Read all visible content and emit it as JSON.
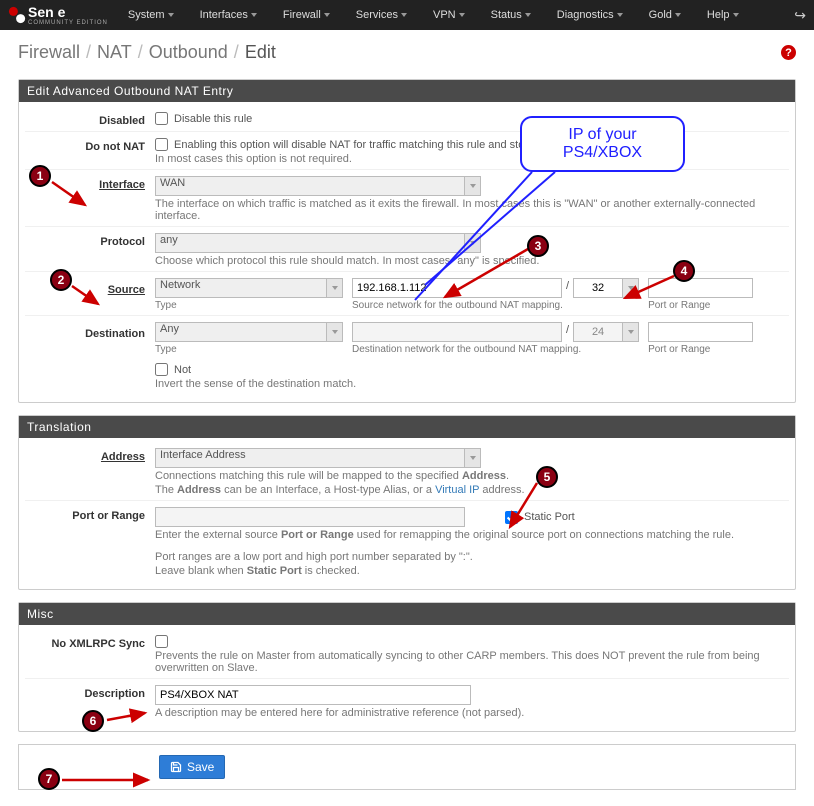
{
  "nav": {
    "logo_main": "Sen e",
    "logo_sub": "COMMUNITY EDITION",
    "items": [
      "System",
      "Interfaces",
      "Firewall",
      "Services",
      "VPN",
      "Status",
      "Diagnostics",
      "Gold",
      "Help"
    ],
    "logout_glyph": "↪"
  },
  "breadcrumb": {
    "parts": [
      "Firewall",
      "NAT",
      "Outbound",
      "Edit"
    ],
    "help_glyph": "?"
  },
  "panel1": {
    "title": "Edit Advanced Outbound NAT Entry",
    "disabled": {
      "label": "Disabled",
      "cb_label": "Disable this rule"
    },
    "donotnat": {
      "label": "Do not NAT",
      "cb_label": "Enabling this option will disable NAT for traffic matching this rule and stop proces",
      "help": "In most cases this option is not required."
    },
    "interface": {
      "label": "Interface",
      "value": "WAN",
      "help": "The interface on which traffic is matched as it exits the firewall. In most cases this is \"WAN\" or another externally-connected interface."
    },
    "protocol": {
      "label": "Protocol",
      "value": "any",
      "help": "Choose which protocol this rule should match. In most cases \"any\" is specified."
    },
    "source": {
      "label": "Source",
      "type": {
        "label": "Type",
        "value": "Network"
      },
      "addr": {
        "label": "Source network for the outbound NAT mapping.",
        "value": "192.168.1.112"
      },
      "mask": "32",
      "port": {
        "label": "Port or Range",
        "value": ""
      }
    },
    "destination": {
      "label": "Destination",
      "type": {
        "label": "Type",
        "value": "Any"
      },
      "addr": {
        "label": "Destination network for the outbound NAT mapping.",
        "value": ""
      },
      "mask": "24",
      "port": {
        "label": "Port or Range",
        "value": ""
      },
      "not_label": "Not",
      "not_help": "Invert the sense of the destination match."
    }
  },
  "panel2": {
    "title": "Translation",
    "address": {
      "label": "Address",
      "value": "Interface Address",
      "help1": "Connections matching this rule will be mapped to the specified ",
      "help1b": "Address",
      "help1c": ".",
      "help2a": "The ",
      "help2b": "Address",
      "help2c": " can be an Interface, a Host-type Alias, or a ",
      "help2link": "Virtual IP",
      "help2d": " address."
    },
    "port": {
      "label": "Port or Range",
      "static_label": "Static Port",
      "help1": "Enter the external source ",
      "help1b": "Port or Range",
      "help1c": " used for remapping the original source port on connections matching the rule.",
      "help2": "Port ranges are a low port and high port number separated by \":\".",
      "help3a": "Leave blank when ",
      "help3b": "Static Port",
      "help3c": " is checked."
    }
  },
  "panel3": {
    "title": "Misc",
    "xmlrpc": {
      "label": "No XMLRPC Sync",
      "help": "Prevents the rule on Master from automatically syncing to other CARP members. This does NOT prevent the rule from being overwritten on Slave."
    },
    "desc": {
      "label": "Description",
      "value": "PS4/XBOX NAT",
      "help": "A description may be entered here for administrative reference (not parsed)."
    },
    "save": "Save"
  },
  "annotations": {
    "callout_line1": "IP of your",
    "callout_line2": "PS4/XBOX",
    "badges": [
      "1",
      "2",
      "3",
      "4",
      "5",
      "6",
      "7"
    ]
  }
}
